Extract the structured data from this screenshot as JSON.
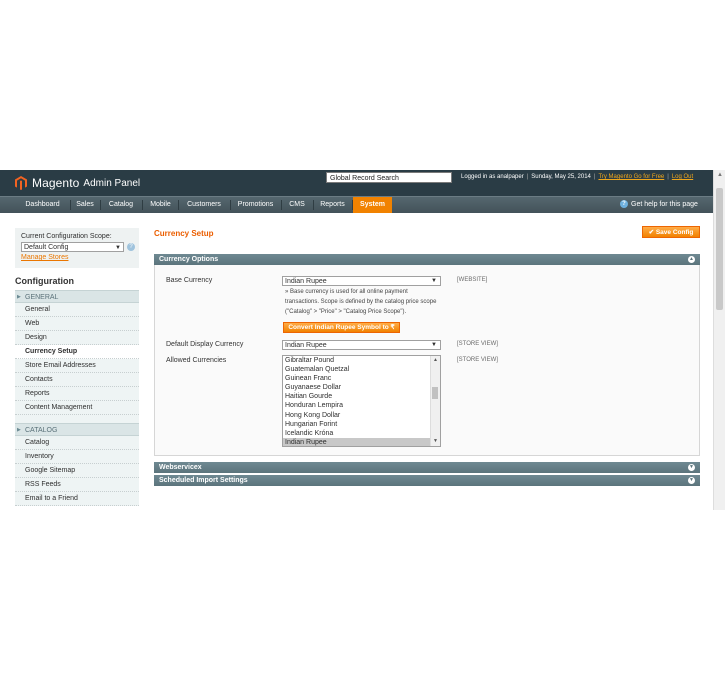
{
  "header": {
    "logo_text": "Magento",
    "logo_sub": "Admin Panel",
    "search_value": "Global Record Search",
    "logged_in": "Logged in as analpaper",
    "date": "Sunday, May 25, 2014",
    "try_link": "Try Magento Go for Free",
    "logout": "Log Out",
    "help": "Get help for this page"
  },
  "nav": [
    "Dashboard",
    "Sales",
    "Catalog",
    "Mobile",
    "Customers",
    "Promotions",
    "CMS",
    "Reports",
    "System"
  ],
  "sidebar": {
    "scope_label": "Current Configuration Scope:",
    "scope_value": "Default Config",
    "manage_stores": "Manage Stores",
    "config_title": "Configuration",
    "general_head": "GENERAL",
    "general_items": [
      "General",
      "Web",
      "Design",
      "Currency Setup",
      "Store Email Addresses",
      "Contacts",
      "Reports",
      "Content Management"
    ],
    "catalog_head": "CATALOG",
    "catalog_items": [
      "Catalog",
      "Inventory",
      "Google Sitemap",
      "RSS Feeds",
      "Email to a Friend"
    ]
  },
  "main": {
    "title": "Currency Setup",
    "save": "Save Config",
    "section_currency": "Currency Options",
    "base_label": "Base Currency",
    "base_value": "Indian Rupee",
    "base_scope": "[WEBSITE]",
    "note": "Base currency is used for all online payment transactions. Scope is defined by the catalog price scope (\"Catalog\" > \"Price\" > \"Catalog Price Scope\").",
    "convert_btn": "Convert Indian Rupee Symbol to ₹",
    "display_label": "Default Display Currency",
    "display_value": "Indian Rupee",
    "display_scope": "[STORE VIEW]",
    "allowed_label": "Allowed Currencies",
    "allowed_scope": "[STORE VIEW]",
    "allowed_options": [
      "Gibraltar Pound",
      "Guatemalan Quetzal",
      "Guinean Franc",
      "Guyanaese Dollar",
      "Haitian Gourde",
      "Honduran Lempira",
      "Hong Kong Dollar",
      "Hungarian Forint",
      "Icelandic Króna",
      "Indian Rupee"
    ],
    "section_webservicex": "Webservicex",
    "section_import": "Scheduled Import Settings"
  },
  "colors": {
    "accent": "#eb5e00",
    "header_bg": "#2a3c45",
    "nav_active": "#f18200",
    "section_bg": "#5b747c"
  }
}
